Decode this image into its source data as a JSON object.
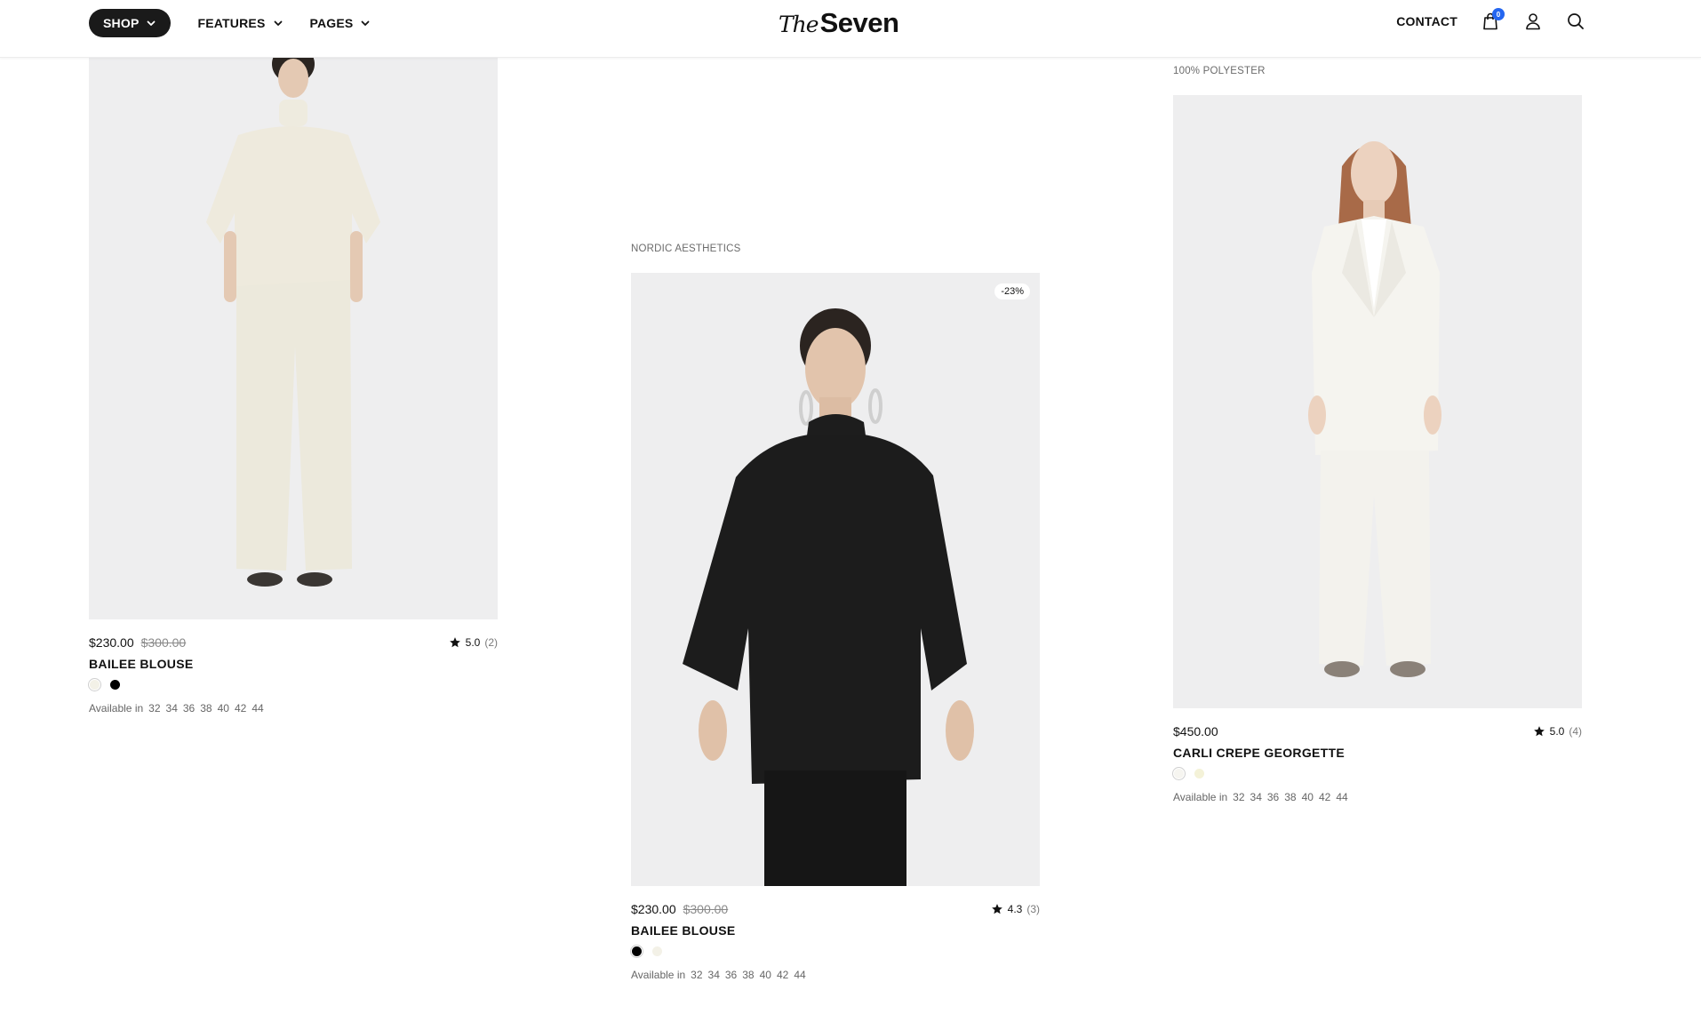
{
  "header": {
    "nav": {
      "shop": "SHOP",
      "features": "FEATURES",
      "pages": "PAGES"
    },
    "logo": {
      "the": "The",
      "seven": "Seven"
    },
    "contact": "CONTACT",
    "cart_count": "0",
    "icons": [
      "shopping-bag-icon",
      "account-icon",
      "search-icon"
    ]
  },
  "products": [
    {
      "eyebrow": "",
      "price": "$230.00",
      "old_price": "$300.00",
      "rating": "5.0",
      "rating_count": "(2)",
      "title": "BAILEE BLOUSE",
      "swatches": [
        "#f3f1e7",
        "#000000"
      ],
      "available_label": "Available in",
      "sizes": [
        "32",
        "34",
        "36",
        "38",
        "40",
        "42",
        "44"
      ]
    },
    {
      "eyebrow": "NORDIC AESTHETICS",
      "discount": "-23%",
      "price": "$230.00",
      "old_price": "$300.00",
      "rating": "4.3",
      "rating_count": "(3)",
      "title": "BAILEE BLOUSE",
      "swatches": [
        "#000000",
        "#f3f1e7"
      ],
      "available_label": "Available in",
      "sizes": [
        "32",
        "34",
        "36",
        "38",
        "40",
        "42",
        "44"
      ]
    },
    {
      "eyebrow": "100% POLYESTER",
      "price": "$450.00",
      "rating": "5.0",
      "rating_count": "(4)",
      "title": "CARLI CREPE GEORGETTE",
      "swatches": [
        "#f6f5f0",
        "#f4f2d8"
      ],
      "available_label": "Available in",
      "sizes": [
        "32",
        "34",
        "36",
        "38",
        "40",
        "42",
        "44"
      ]
    }
  ],
  "colors": {
    "accent": "#2466f0",
    "dark": "#1a1a1a",
    "image_bg": "#eeeeef"
  }
}
